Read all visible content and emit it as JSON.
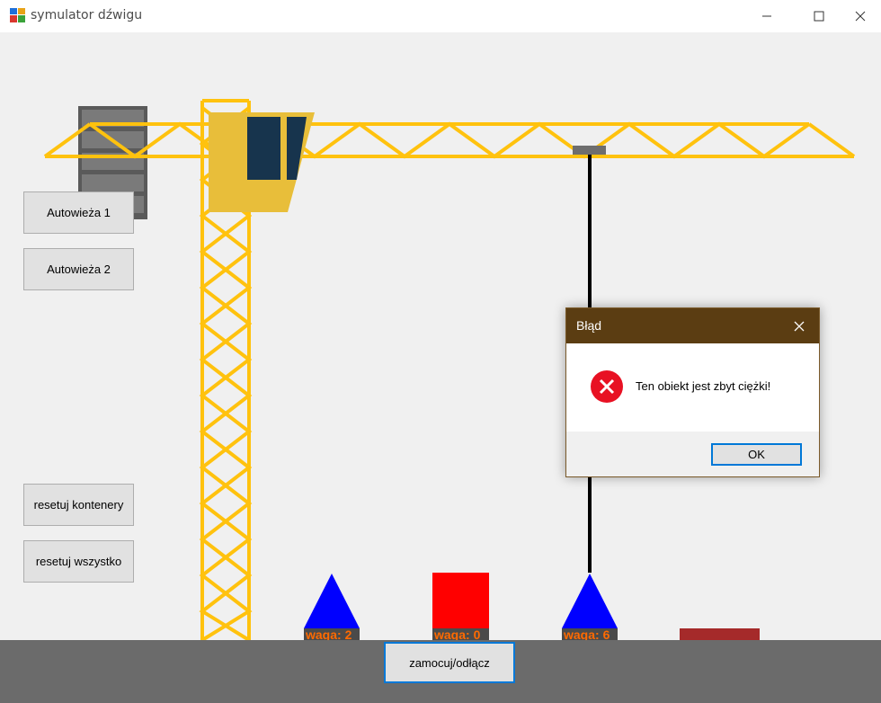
{
  "window": {
    "title": "symulator dźwigu",
    "minimize_icon": "minimize-icon",
    "maximize_icon": "maximize-icon",
    "close_icon": "close-icon"
  },
  "left_panel": {
    "autotower1_label": "Autowieża 1",
    "autotower2_label": "Autowieża 2",
    "reset_containers_label": "resetuj kontenery",
    "reset_all_label": "resetuj wszystko"
  },
  "bottom": {
    "attach_label": "zamocuj/odłącz"
  },
  "objects": [
    {
      "shape": "triangle",
      "color": "#0000ff",
      "label": "waga: 2"
    },
    {
      "shape": "square",
      "color": "#ff0000",
      "label": "waga: 0"
    },
    {
      "shape": "triangle",
      "color": "#0000ff",
      "label": "waga: 6"
    },
    {
      "shape": "bar",
      "color": "#a52a2a",
      "label": ""
    }
  ],
  "dialog": {
    "title": "Błąd",
    "message": "Ten obiekt jest zbyt ciężki!",
    "ok_label": "OK",
    "icon": "error-icon",
    "close_icon": "close-icon"
  },
  "colors": {
    "crane": "#ffc20e",
    "cab": "#e8be3a",
    "cab_window": "#17344d",
    "counterweight": "#5a5a5a",
    "ground": "#6b6b6b",
    "dialog_title_bg": "#5b3d12"
  }
}
